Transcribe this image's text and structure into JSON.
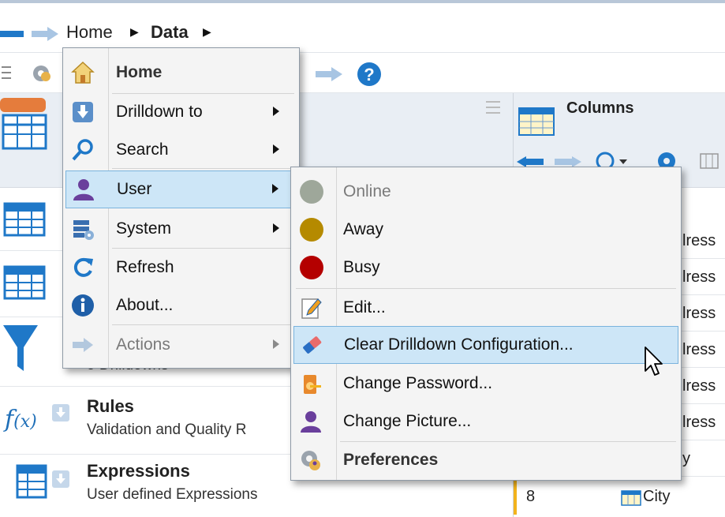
{
  "breadcrumb": {
    "home": "Home",
    "data": "Data"
  },
  "left_panel": {
    "rows": [
      {
        "title": "",
        "subtitle": "5 Drilldowns"
      },
      {
        "title": "Rules",
        "subtitle": "Validation and Quality R"
      },
      {
        "title": "Expressions",
        "subtitle": "User defined Expressions"
      }
    ]
  },
  "right_panel": {
    "header_label": "Columns",
    "cells": [
      "lress",
      "lress",
      "lress",
      "lress",
      "lress",
      "lress",
      "y"
    ],
    "last_row": {
      "number": "8",
      "value": "City"
    }
  },
  "main_menu": {
    "items": [
      {
        "label": "Home",
        "icon": "home-icon",
        "bold": true
      },
      {
        "label": "Drilldown to",
        "icon": "drilldown-icon",
        "submenu": true
      },
      {
        "label": "Search",
        "icon": "search-icon",
        "submenu": true
      },
      {
        "label": "User",
        "icon": "user-icon",
        "submenu": true,
        "highlighted": true
      },
      {
        "label": "System",
        "icon": "system-icon",
        "submenu": true
      },
      {
        "label": "Refresh",
        "icon": "refresh-icon"
      },
      {
        "label": "About...",
        "icon": "info-icon"
      },
      {
        "label": "Actions",
        "icon": "arrow-right-icon",
        "submenu": true,
        "disabled": true
      }
    ]
  },
  "user_submenu": {
    "items": [
      {
        "label": "Online",
        "icon": "status-online-icon",
        "color": "#9ea79a",
        "disabled": true
      },
      {
        "label": "Away",
        "icon": "status-away-icon",
        "color": "#b58a00"
      },
      {
        "label": "Busy",
        "icon": "status-busy-icon",
        "color": "#b40000"
      },
      {
        "label": "Edit...",
        "icon": "edit-icon"
      },
      {
        "label": "Clear Drilldown Configuration...",
        "icon": "eraser-icon",
        "highlighted": true
      },
      {
        "label": "Change Password...",
        "icon": "key-icon"
      },
      {
        "label": "Change Picture...",
        "icon": "user-picture-icon"
      },
      {
        "label": "Preferences",
        "icon": "preferences-icon",
        "bold": true
      }
    ]
  },
  "colors": {
    "accent_blue": "#1f78c8",
    "menu_highlight": "#cde6f7",
    "menu_highlight_border": "#7ab3dd",
    "header_bg": "#e9eef4"
  }
}
